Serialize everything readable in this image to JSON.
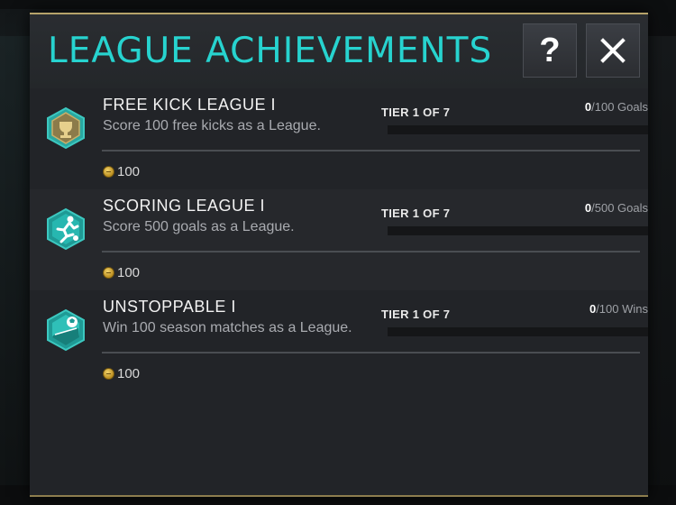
{
  "modal": {
    "title": "LEAGUE ACHIEVEMENTS",
    "help_label": "?",
    "close_icon": "close-icon"
  },
  "colors": {
    "accent": "#27d3cf",
    "gold_border": "#b6a36a",
    "panel": "#26282c"
  },
  "achievements": [
    {
      "title": "FREE KICK LEAGUE I",
      "description": "Score 100 free kicks as a League.",
      "tier": "TIER 1 OF 7",
      "progress_current": "0",
      "progress_total": "/100 Goals",
      "progress_fraction": 0,
      "reward": "100",
      "badge_icon": "trophy-badge-icon"
    },
    {
      "title": "SCORING LEAGUE I",
      "description": "Score 500 goals as a League.",
      "tier": "TIER 1 OF 7",
      "progress_current": "0",
      "progress_total": "/500 Goals",
      "progress_fraction": 0,
      "reward": "100",
      "badge_icon": "player-kick-badge-icon"
    },
    {
      "title": "UNSTOPPABLE I",
      "description": "Win 100 season matches as a League.",
      "tier": "TIER 1 OF 7",
      "progress_current": "0",
      "progress_total": "/100 Wins",
      "progress_fraction": 0,
      "reward": "100",
      "badge_icon": "pitch-ball-badge-icon"
    }
  ]
}
